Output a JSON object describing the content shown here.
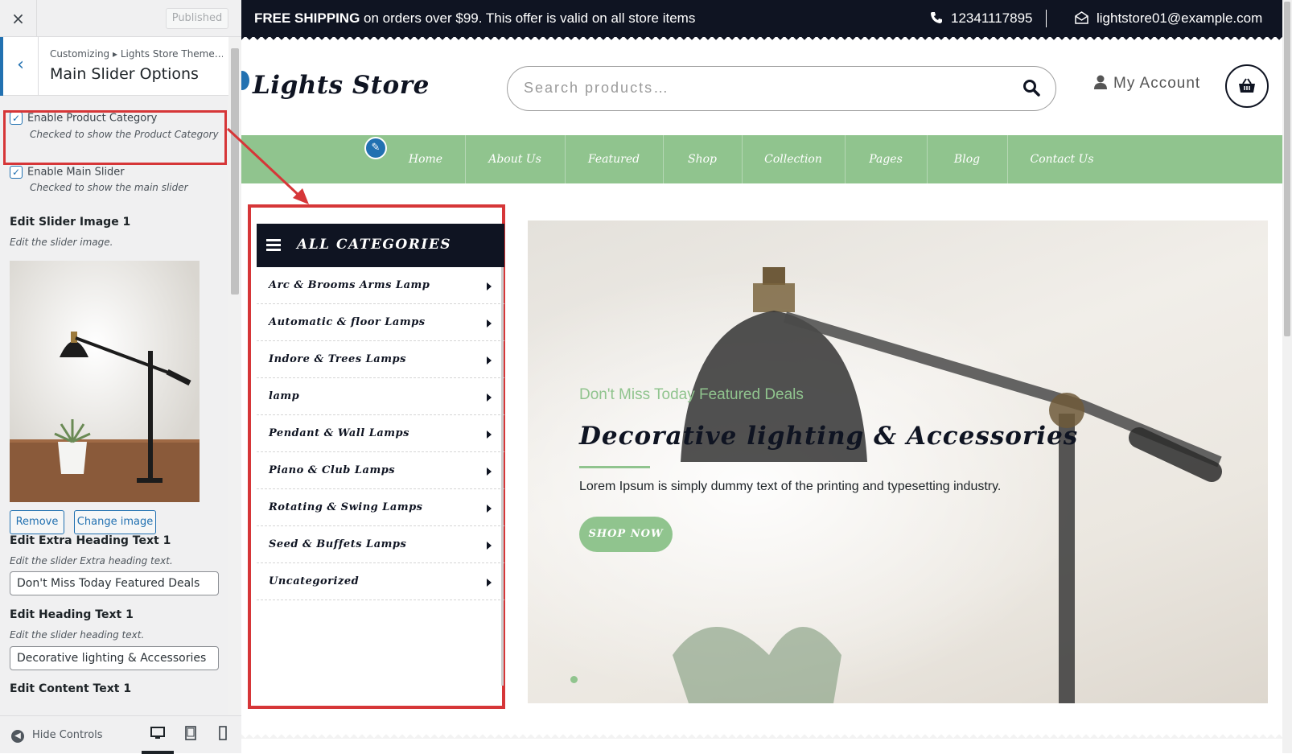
{
  "customizer": {
    "close_label": "×",
    "publish_label": "Published",
    "breadcrumb": "Customizing ▸ Lights Store Theme…",
    "section_title": "Main Slider Options",
    "controls": {
      "enable_category": {
        "label": "Enable Product Category",
        "desc": "Checked to show the Product Category",
        "checked": true
      },
      "enable_slider": {
        "label": "Enable Main Slider",
        "desc": "Checked to show the main slider",
        "checked": true
      },
      "slider_image": {
        "label": "Edit Slider Image 1",
        "desc": "Edit the slider image.",
        "remove_label": "Remove",
        "change_label": "Change image"
      },
      "extra_heading": {
        "label": "Edit Extra Heading Text 1",
        "desc": "Edit the slider Extra heading text.",
        "value": "Don't Miss Today Featured Deals"
      },
      "heading": {
        "label": "Edit Heading Text 1",
        "desc": "Edit the slider heading text.",
        "value": "Decorative lighting & Accessories"
      },
      "content": {
        "label": "Edit Content Text 1"
      }
    },
    "footer": {
      "hide_label": "Hide Controls",
      "devices": [
        "desktop-icon",
        "tablet-icon",
        "mobile-icon"
      ],
      "active_device": "desktop"
    }
  },
  "site": {
    "topbar": {
      "shipping_bold": "FREE SHIPPING",
      "shipping_rest": " on orders over $99. This offer is valid on all store items",
      "phone": "12341117895",
      "email": "lightstore01@example.com"
    },
    "logo": "Lights Store",
    "search_placeholder": "Search products…",
    "account_label": "My Account",
    "nav": [
      "Home",
      "About Us",
      "Featured",
      "Shop",
      "Collection",
      "Pages",
      "Blog",
      "Contact Us"
    ],
    "categories_title": "ALL CATEGORIES",
    "categories": [
      "Arc & Brooms Arms Lamp",
      "Automatic & floor Lamps",
      "Indore & Trees Lamps",
      "lamp",
      "Pendant & Wall Lamps",
      "Piano & Club Lamps",
      "Rotating & Swing Lamps",
      "Seed & Buffets Lamps",
      "Uncategorized"
    ],
    "slider": {
      "extra_heading": "Don't Miss Today Featured Deals",
      "heading": "Decorative lighting & Accessories",
      "content": "Lorem Ipsum is simply dummy text of the printing and typesetting industry.",
      "button": "SHOP NOW"
    },
    "colors": {
      "accent": "#90c48e",
      "dark": "#0f1422",
      "highlight": "#d63638",
      "wp_blue": "#2271b1"
    }
  }
}
